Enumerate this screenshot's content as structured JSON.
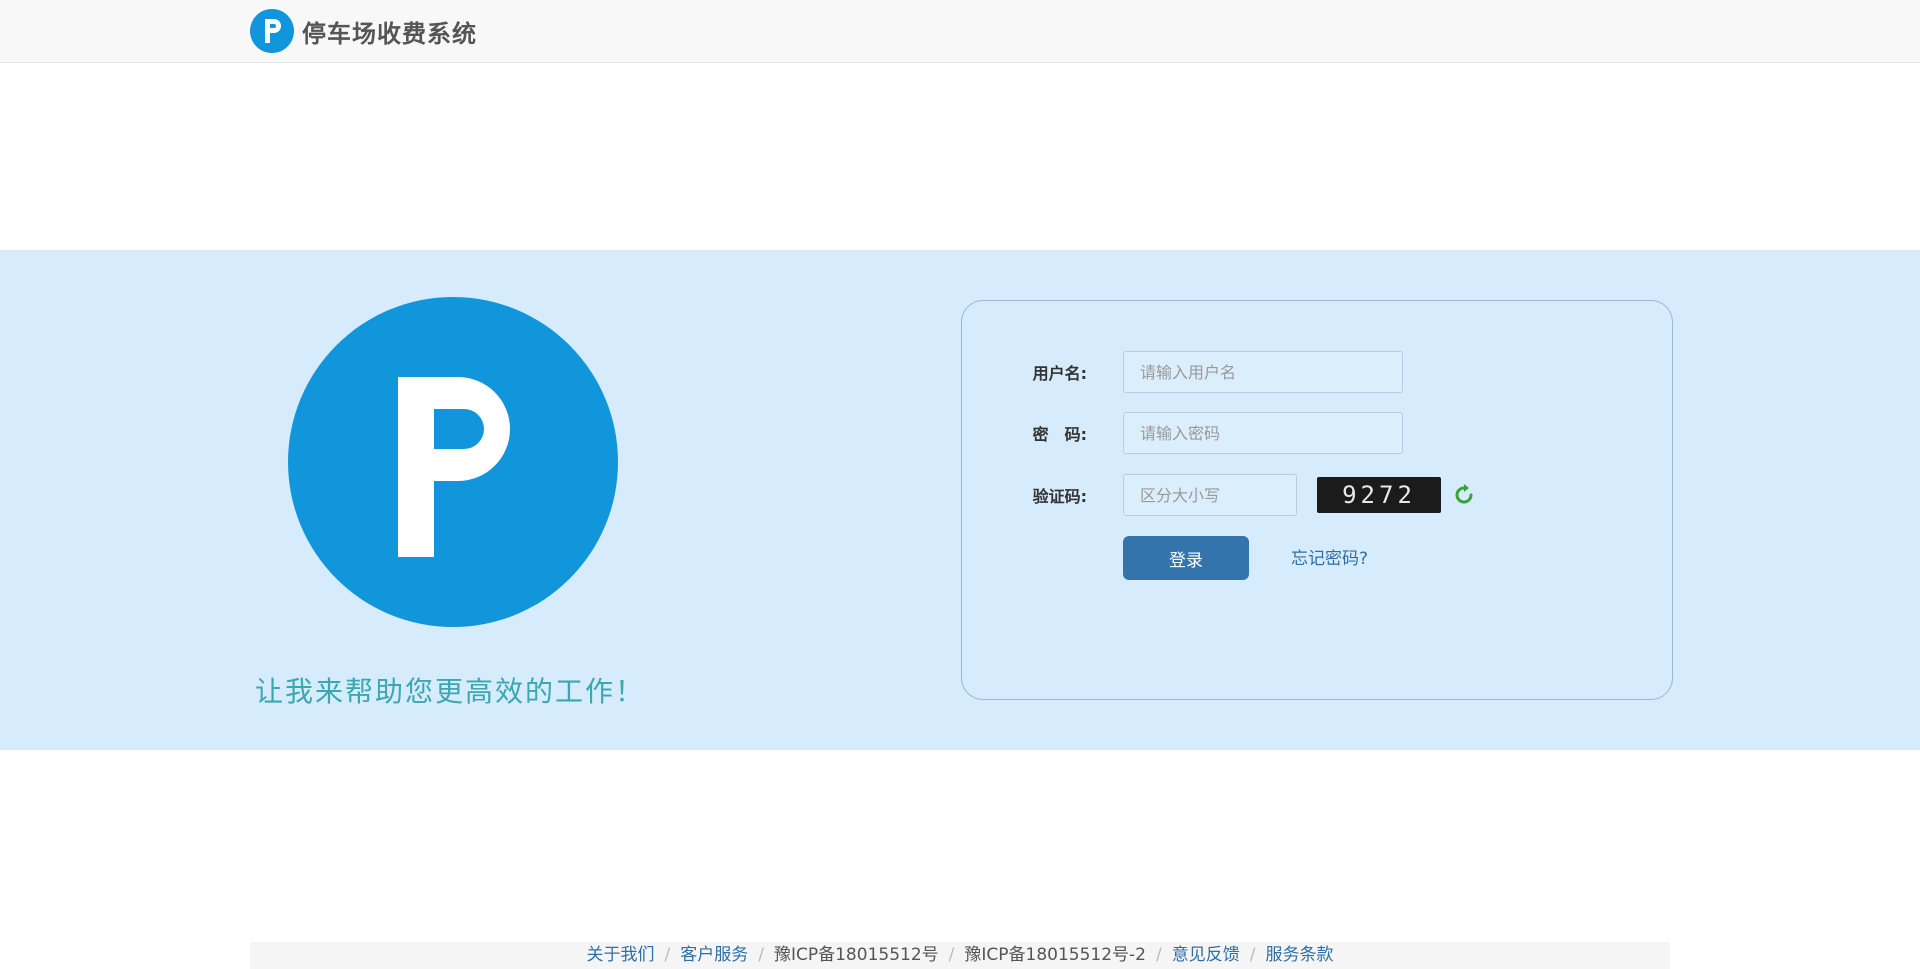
{
  "header": {
    "brand_name": "停车场收费系统",
    "logo_letter": "P"
  },
  "slogan": "让我来帮助您更高效的工作！",
  "login": {
    "username_label": "用户名:",
    "username_placeholder": "请输入用户名",
    "password_label": "密　码:",
    "password_placeholder": "请输入密码",
    "captcha_label": "验证码:",
    "captcha_placeholder": "区分大小写",
    "captcha_text": "9272",
    "login_button": "登录",
    "forgot_link": "忘记密码?"
  },
  "footer": {
    "about": "关于我们",
    "service": "客户服务",
    "icp1": "豫ICP备18015512号",
    "icp2": "豫ICP备18015512号-2",
    "feedback": "意见反馈",
    "terms": "服务条款",
    "separator": "/"
  },
  "colors": {
    "brand_blue": "#1296db",
    "band_bg": "#d6ebfb",
    "button_bg": "#3374ac",
    "slogan": "#3aa8b0"
  }
}
